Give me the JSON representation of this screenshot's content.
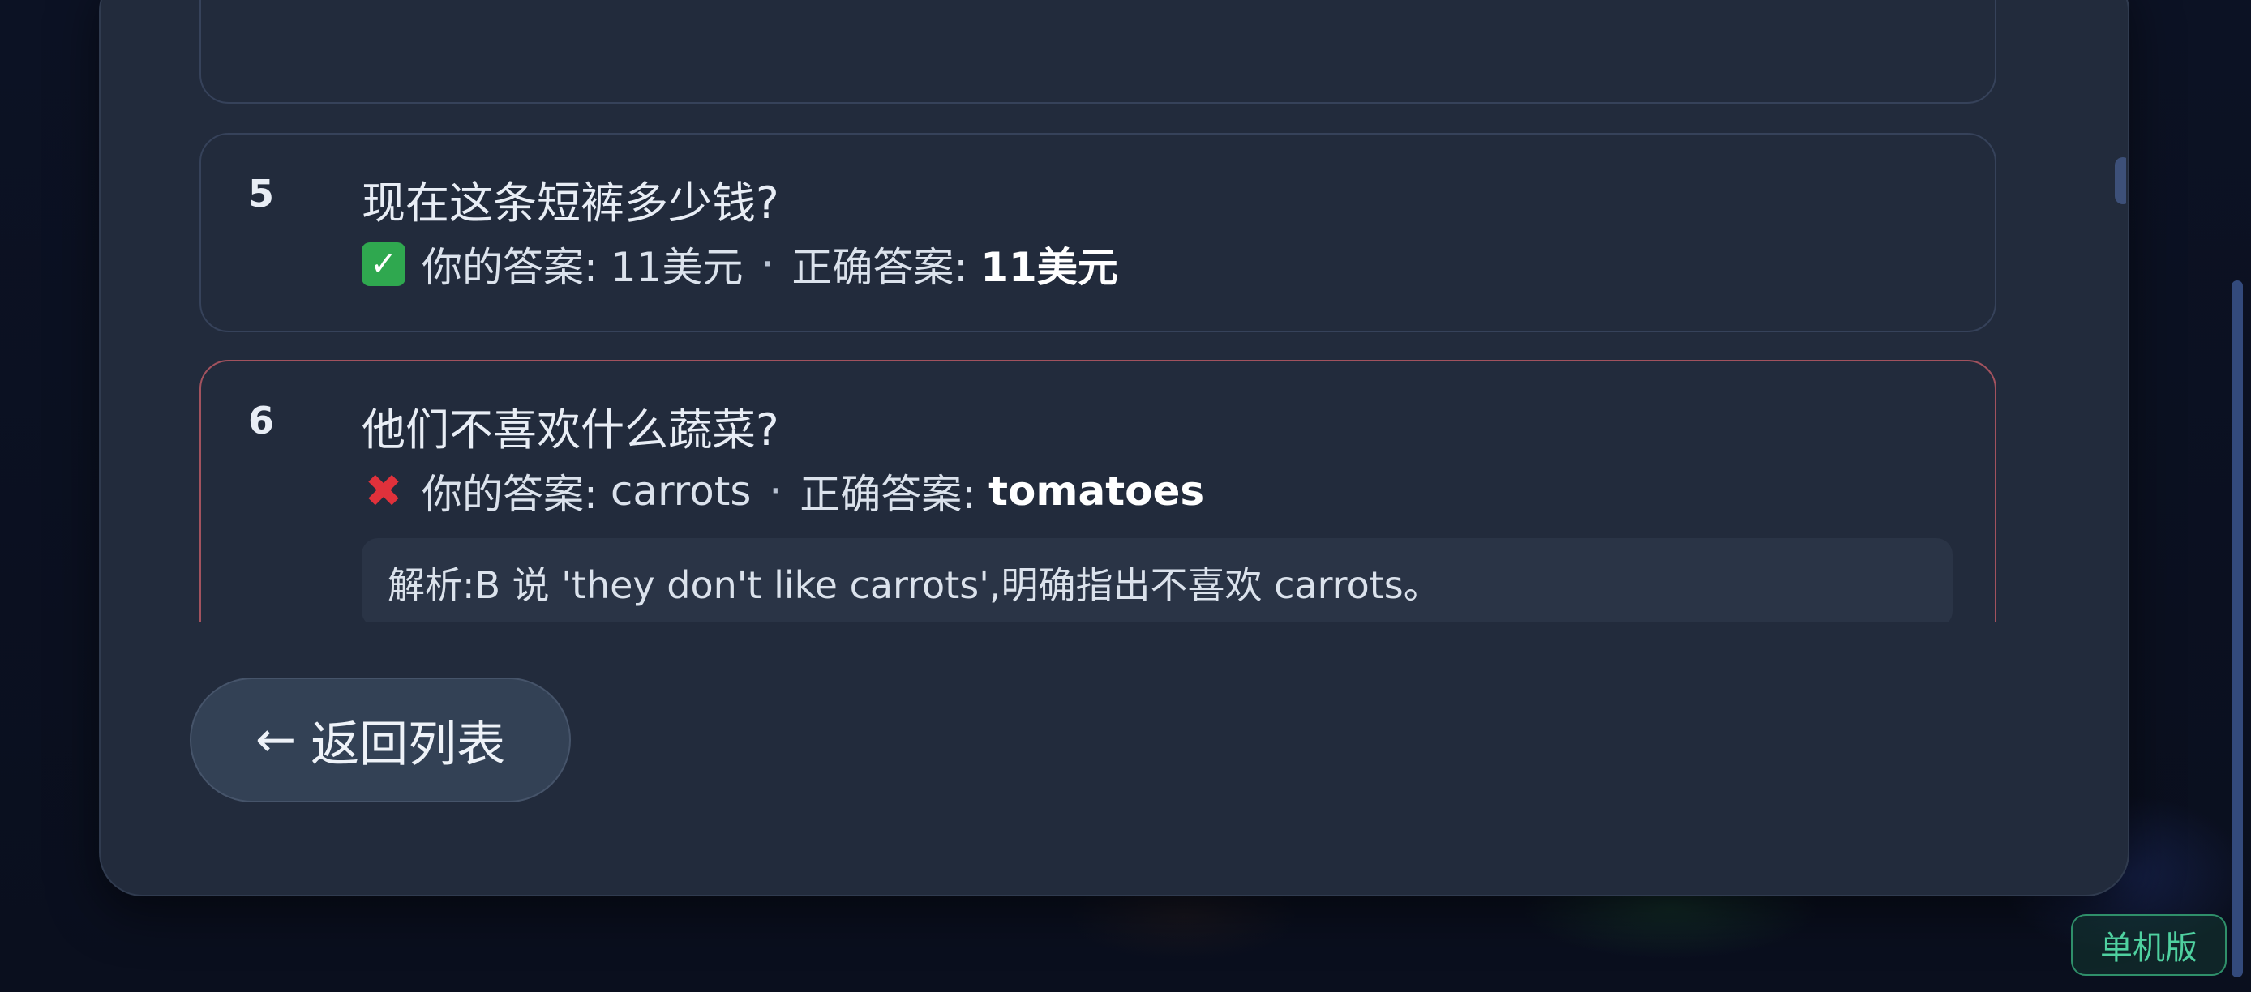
{
  "review": {
    "items": [
      {
        "number": "5",
        "question": "现在这条短裤多少钱?",
        "status": "correct",
        "status_icon": "check-icon",
        "your_answer_label": "你的答案:",
        "your_answer": "11美元",
        "separator": "·",
        "correct_answer_label": "正确答案:",
        "correct_answer": "11美元"
      },
      {
        "number": "6",
        "question": "他们不喜欢什么蔬菜?",
        "status": "wrong",
        "status_icon": "cross-icon",
        "your_answer_label": "你的答案:",
        "your_answer": "carrots",
        "separator": "·",
        "correct_answer_label": "正确答案:",
        "correct_answer": "tomatoes",
        "explanation": "解析:B 说 'they don't like carrots',明确指出不喜欢 carrots。"
      }
    ]
  },
  "actions": {
    "back_arrow": "←",
    "back_label": "返回列表"
  },
  "badge": {
    "label": "单机版"
  },
  "colors": {
    "correct": "#2fa84f",
    "wrong": "#e0313b",
    "wrong_border": "#a2525e",
    "badge": "#4fd1a0"
  }
}
